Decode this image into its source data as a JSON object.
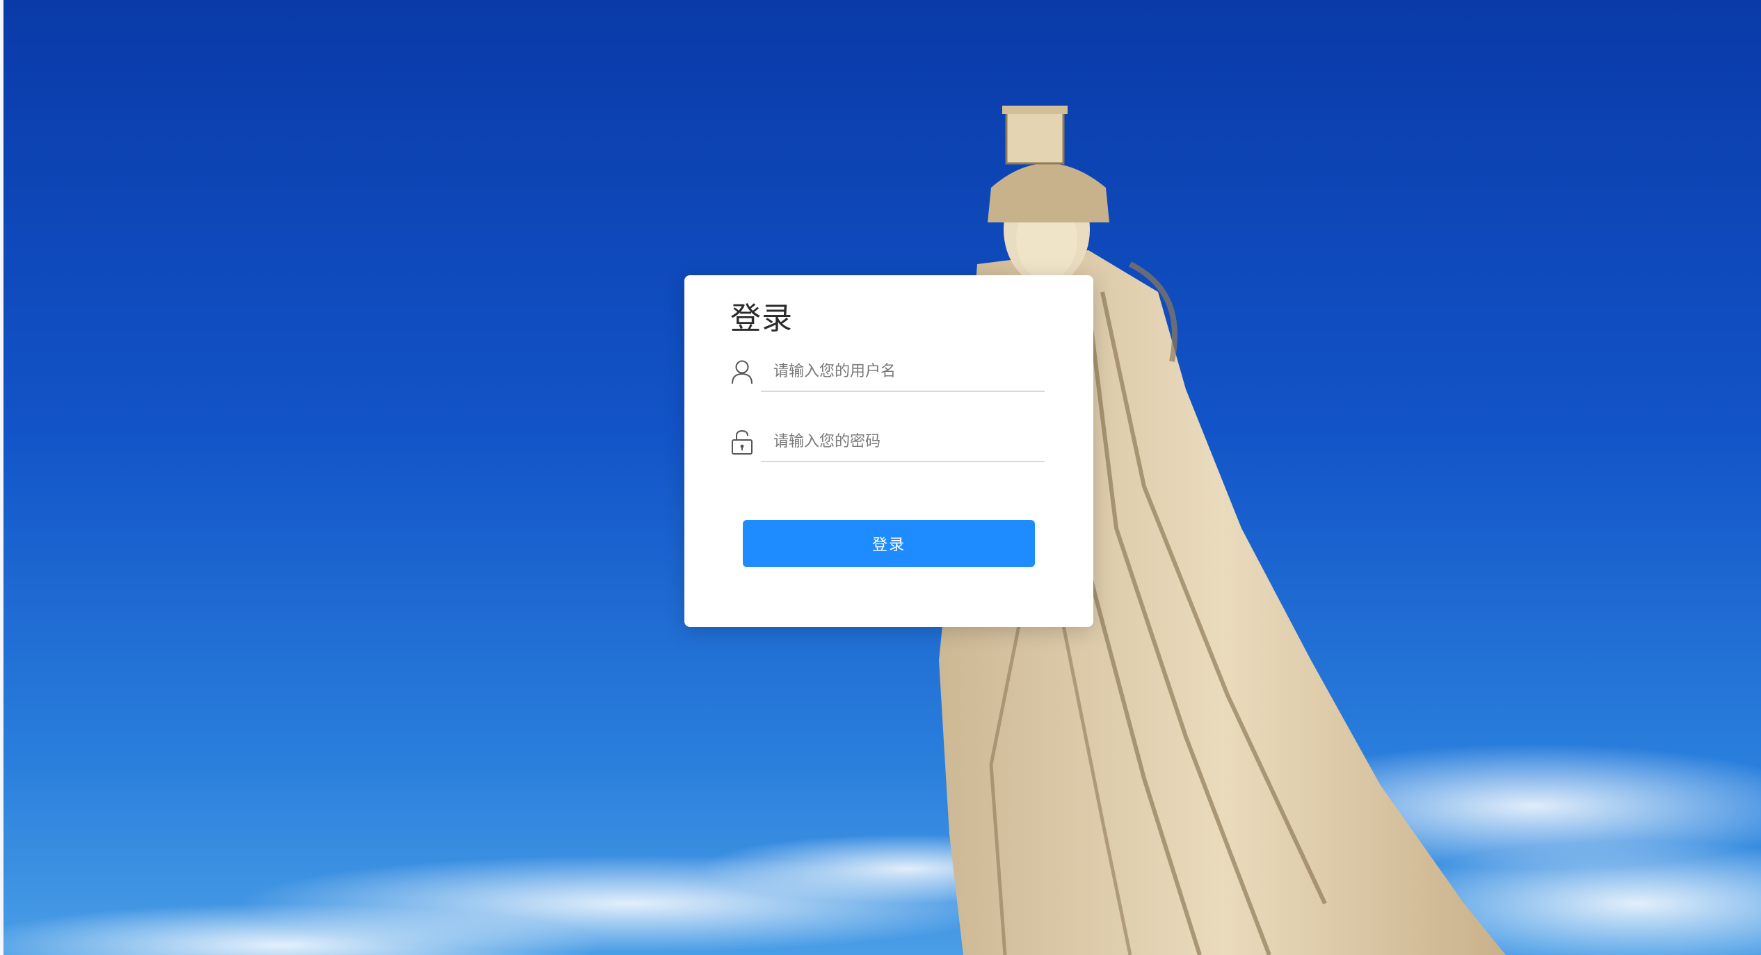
{
  "login": {
    "title": "登录",
    "username": {
      "placeholder": "请输入您的用户名",
      "value": "",
      "icon": "user-icon"
    },
    "password": {
      "placeholder": "请输入您的密码",
      "value": "",
      "icon": "lock-icon"
    },
    "submit_label": "登录"
  },
  "colors": {
    "primary_button": "#1e8bff",
    "sky_top": "#0a3fb0",
    "sky_bottom": "#2f8fe0",
    "statue": "#e7d6b6"
  }
}
